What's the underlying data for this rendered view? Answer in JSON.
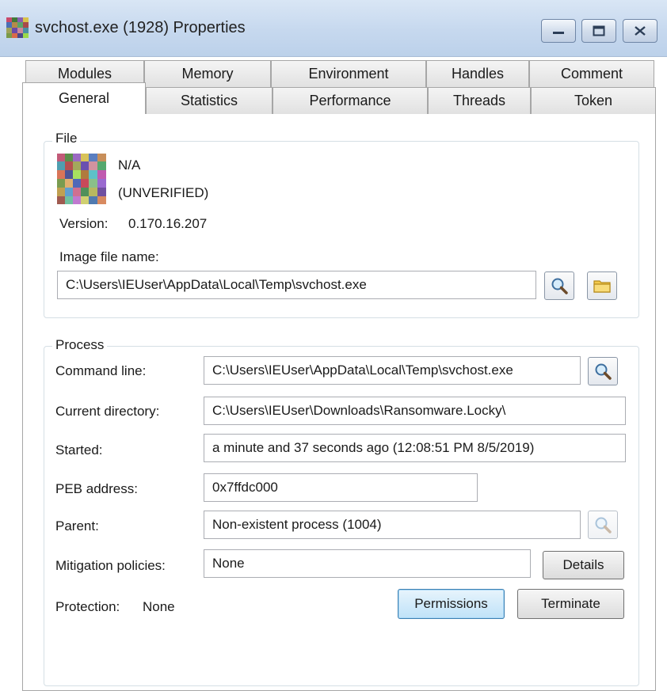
{
  "window": {
    "title": "svchost.exe (1928) Properties",
    "controls": {
      "minimize": "minimize",
      "maximize": "maximize",
      "close": "close"
    }
  },
  "tabs": {
    "row1": [
      "Modules",
      "Memory",
      "Environment",
      "Handles",
      "Comment"
    ],
    "row2": [
      "General",
      "Statistics",
      "Performance",
      "Threads",
      "Token"
    ],
    "active": "General"
  },
  "file": {
    "legend": "File",
    "company": "N/A",
    "verification": "(UNVERIFIED)",
    "version_label": "Version:",
    "version_value": "0.170.16.207",
    "image_label": "Image file name:",
    "image_path": "C:\\Users\\IEUser\\AppData\\Local\\Temp\\svchost.exe"
  },
  "process": {
    "legend": "Process",
    "command_line_label": "Command line:",
    "command_line": "C:\\Users\\IEUser\\AppData\\Local\\Temp\\svchost.exe",
    "current_directory_label": "Current directory:",
    "current_directory": "C:\\Users\\IEUser\\Downloads\\Ransomware.Locky\\",
    "started_label": "Started:",
    "started": "a minute and 37 seconds ago (12:08:51 PM 8/5/2019)",
    "peb_label": "PEB address:",
    "peb": "0x7ffdc000",
    "parent_label": "Parent:",
    "parent": "Non-existent process (1004)",
    "mitigation_label": "Mitigation policies:",
    "mitigation": "None",
    "details_label": "Details",
    "protection_label": "Protection:",
    "protection": "None",
    "permissions_label": "Permissions",
    "terminate_label": "Terminate"
  }
}
